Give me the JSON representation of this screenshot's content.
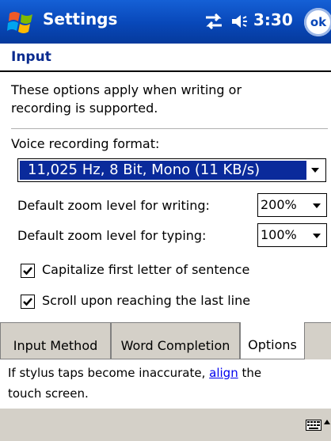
{
  "titlebar": {
    "title": "Settings",
    "time": "3:30",
    "ok_label": "ok",
    "icons": [
      "windows-start-icon",
      "connectivity-icon",
      "speaker-icon"
    ]
  },
  "page": {
    "title": "Input"
  },
  "options": {
    "intro_line1": "These options apply when writing or",
    "intro_line2": "recording is supported.",
    "voice_label": "Voice recording format:",
    "voice_value": "11,025 Hz, 8 Bit, Mono (11 KB/s)",
    "zoom_writing_label": "Default zoom level for writing:",
    "zoom_writing_value": "200%",
    "zoom_typing_label": "Default zoom level for typing:",
    "zoom_typing_value": "100%",
    "capitalize_label": "Capitalize first letter of sentence",
    "capitalize_checked": true,
    "scroll_label": "Scroll upon reaching the last line",
    "scroll_checked": true
  },
  "tabs": [
    {
      "label": "Input Method",
      "active": false
    },
    {
      "label": "Word Completion",
      "active": false
    },
    {
      "label": "Options",
      "active": true
    }
  ],
  "help": {
    "text_before": "If stylus taps become inaccurate, ",
    "link": "align",
    "text_after": " the",
    "line2": "touch screen."
  },
  "menubar": {
    "icons": [
      "keyboard-icon",
      "input-panel-arrow-icon"
    ]
  },
  "colors": {
    "titlebar": "#0847b8",
    "selection": "#0a2a9b",
    "page_title": "#0a2b8f",
    "chrome": "#d4d0c8",
    "link": "#0000ee"
  }
}
